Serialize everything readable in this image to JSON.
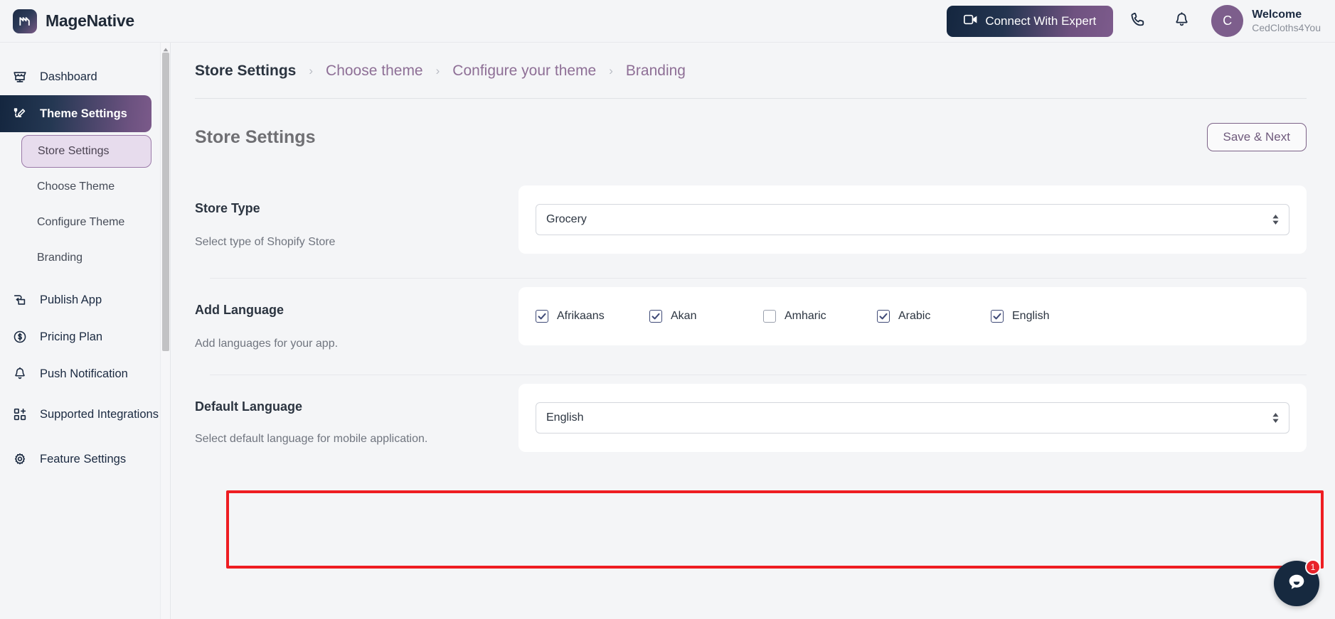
{
  "header": {
    "brand_name": "MageNative",
    "logo_icon": "magenative-logo-icon",
    "expert_button": "Connect With Expert",
    "expert_icon": "video-camera-icon",
    "phone_icon": "phone-icon",
    "bell_icon": "bell-icon",
    "avatar_initial": "C",
    "welcome_title": "Welcome",
    "welcome_user": "CedCloths4You"
  },
  "sidebar": {
    "items": [
      {
        "label": "Dashboard",
        "icon": "store-icon",
        "active": false
      },
      {
        "label": "Theme Settings",
        "icon": "theme-edit-icon",
        "active": true
      },
      {
        "label": "Publish App",
        "icon": "publish-icon",
        "active": false
      },
      {
        "label": "Pricing Plan",
        "icon": "dollar-circle-icon",
        "active": false
      },
      {
        "label": "Push Notification",
        "icon": "bell-icon",
        "active": false
      },
      {
        "label": "Supported Integrations",
        "icon": "grid-plus-icon",
        "active": false
      },
      {
        "label": "Feature Settings",
        "icon": "gear-icon",
        "active": false
      }
    ],
    "sub_items": [
      {
        "label": "Store Settings",
        "selected": true
      },
      {
        "label": "Choose Theme",
        "selected": false
      },
      {
        "label": "Configure Theme",
        "selected": false
      },
      {
        "label": "Branding",
        "selected": false
      }
    ]
  },
  "breadcrumb": {
    "items": [
      {
        "label": "Store Settings",
        "current": true
      },
      {
        "label": "Choose theme",
        "current": false
      },
      {
        "label": "Configure your theme",
        "current": false
      },
      {
        "label": "Branding",
        "current": false
      }
    ],
    "separator": "›"
  },
  "page": {
    "title": "Store Settings",
    "save_button": "Save & Next"
  },
  "form": {
    "store_type": {
      "label": "Store Type",
      "description": "Select type of Shopify Store",
      "value": "Grocery"
    },
    "add_language": {
      "label": "Add Language",
      "description": "Add languages for your app.",
      "options": [
        {
          "label": "Afrikaans",
          "checked": true
        },
        {
          "label": "Akan",
          "checked": true
        },
        {
          "label": "Amharic",
          "checked": false
        },
        {
          "label": "Arabic",
          "checked": true
        },
        {
          "label": "English",
          "checked": true
        }
      ]
    },
    "default_language": {
      "label": "Default Language",
      "description": "Select default language for mobile application.",
      "value": "English"
    }
  },
  "chat": {
    "icon": "chat-bubble-icon",
    "badge_count": "1"
  },
  "colors": {
    "accent_purple": "#7d5b8c",
    "navy": "#16293f",
    "highlight_red": "#ee1d22",
    "page_bg": "#f4f5f7"
  }
}
